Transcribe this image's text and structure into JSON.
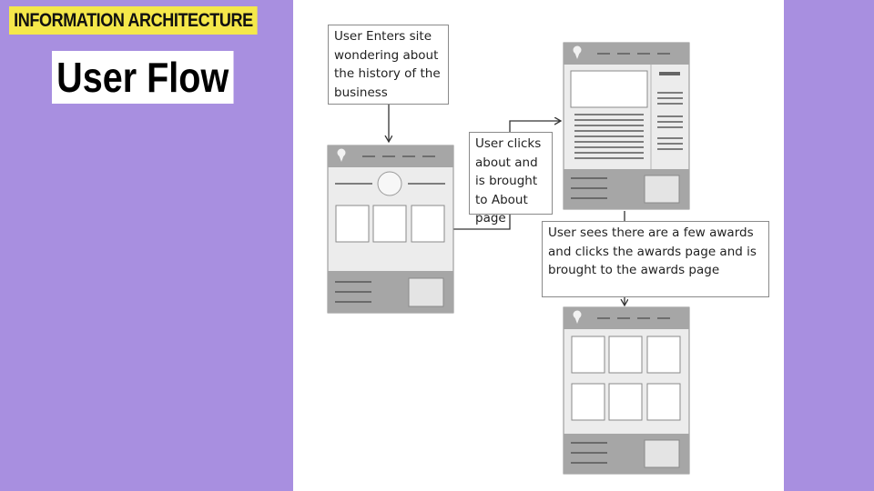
{
  "header": {
    "section_tag": "INFORMATION ARCHITECTURE",
    "title": "User Flow"
  },
  "flow": {
    "step1_note": "User Enters site wondering about the history of the business",
    "step2_note": "User clicks about and is brought to About page",
    "step3_note": "User sees there are a few awards and clicks the awards page and is brought to the awards page"
  },
  "colors": {
    "background": "#a88fe0",
    "tag_highlight": "#f5e84a",
    "wireframe_bar": "#a6a6a6",
    "wireframe_body": "#ececec",
    "wireframe_line": "#7d7d7d"
  },
  "icons": {
    "wireframe_logo": "location-pin-icon"
  }
}
